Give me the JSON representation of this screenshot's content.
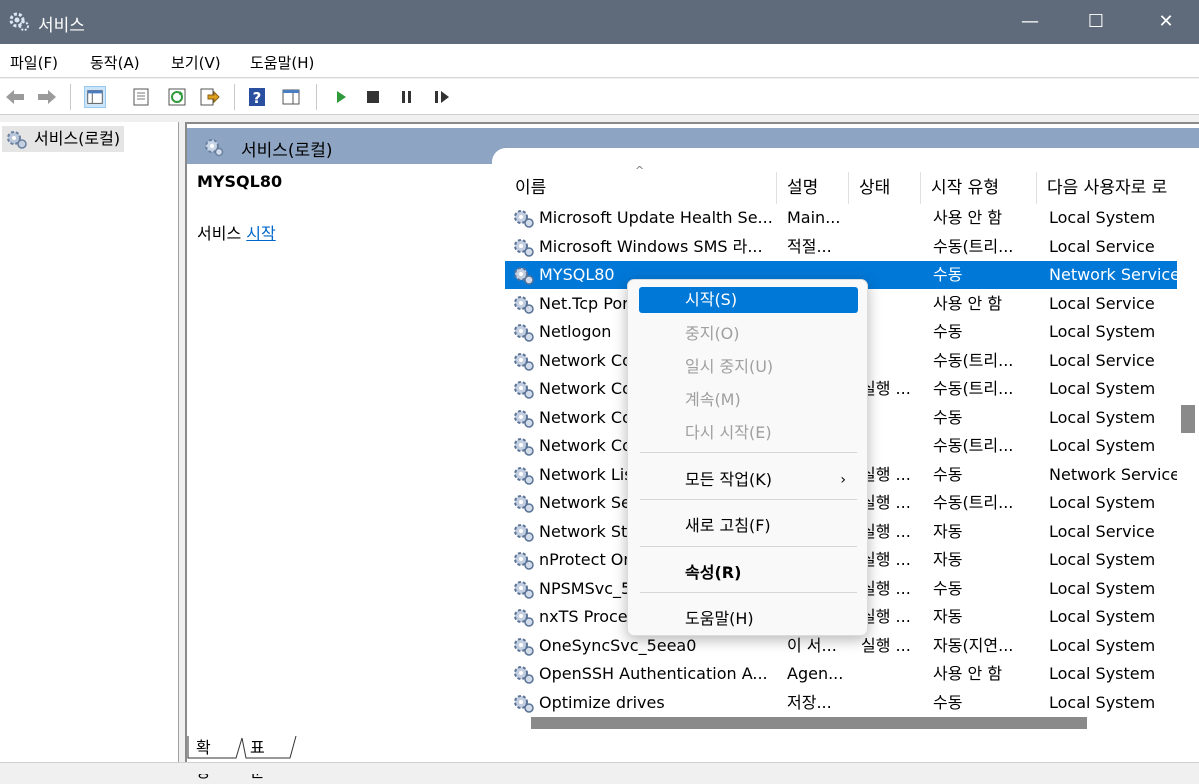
{
  "window": {
    "title": "서비스",
    "controls": {
      "minimize": "—",
      "maximize": "☐",
      "close": "✕"
    }
  },
  "menu": [
    "파일(F)",
    "동작(A)",
    "보기(V)",
    "도움말(H)"
  ],
  "toolbar": [
    "back-arrow-icon",
    "forward-arrow-icon",
    "show-hide-tree-icon",
    "properties-icon",
    "refresh-icon",
    "export-list-icon",
    "help-icon",
    "console-tree-icon",
    "start-service-icon",
    "stop-service-icon",
    "pause-service-icon",
    "resume-service-icon"
  ],
  "tree": {
    "root": "서비스(로컬)"
  },
  "panel": {
    "title": "서비스(로컬)"
  },
  "description": {
    "service_name": "MYSQL80",
    "action_prefix": "서비스 ",
    "action_link": "시작"
  },
  "columns": [
    "이름",
    "설명",
    "상태",
    "시작 유형",
    "다음 사용자로 로"
  ],
  "rows": [
    {
      "name": "Microsoft Update Health Se...",
      "desc": "Main...",
      "status": "",
      "start": "사용 안 함",
      "logon": "Local System"
    },
    {
      "name": "Microsoft Windows SMS 라...",
      "desc": "적절...",
      "status": "",
      "start": "수동(트리...",
      "logon": "Local Service"
    },
    {
      "name": "MYSQL80",
      "desc": "",
      "status": "",
      "start": "수동",
      "logon": "Network Service"
    },
    {
      "name": "Net.Tcp Port Sharing Service",
      "desc": "",
      "status": "",
      "start": "사용 안 함",
      "logon": "Local Service"
    },
    {
      "name": "Netlogon",
      "desc": "",
      "status": "",
      "start": "수동",
      "logon": "Local System"
    },
    {
      "name": "Network Connected Devices",
      "desc": "",
      "status": "",
      "start": "수동(트리...",
      "logon": "Local Service"
    },
    {
      "name": "Network Connection Broker",
      "desc": "",
      "status": "실행 ...",
      "start": "수동(트리...",
      "logon": "Local System"
    },
    {
      "name": "Network Connections",
      "desc": "",
      "status": "",
      "start": "수동",
      "logon": "Local System"
    },
    {
      "name": "Network Connectivity Assistant",
      "desc": "",
      "status": "",
      "start": "수동(트리...",
      "logon": "Local System"
    },
    {
      "name": "Network List Service",
      "desc": "",
      "status": "실행 ...",
      "start": "수동",
      "logon": "Network Service"
    },
    {
      "name": "Network Setup Service",
      "desc": "",
      "status": "실행 ...",
      "start": "수동(트리...",
      "logon": "Local System"
    },
    {
      "name": "Network Store Interface Service",
      "desc": "",
      "status": "실행 ...",
      "start": "자동",
      "logon": "Local Service"
    },
    {
      "name": "nProtect Online Security",
      "desc": "",
      "status": "실행 ...",
      "start": "자동",
      "logon": "Local System"
    },
    {
      "name": "NPSMSvc_5eea0",
      "desc": "",
      "status": "실행 ...",
      "start": "수동",
      "logon": "Local System"
    },
    {
      "name": "nxTS Process Service",
      "desc": "",
      "status": "실행 ...",
      "start": "자동",
      "logon": "Local System"
    },
    {
      "name": "OneSyncSvc_5eea0",
      "desc": "이 서...",
      "status": "실행 ...",
      "start": "자동(지연...",
      "logon": "Local System"
    },
    {
      "name": "OpenSSH Authentication A...",
      "desc": "Agen...",
      "status": "",
      "start": "사용 안 함",
      "logon": "Local System"
    },
    {
      "name": "Optimize drives",
      "desc": "저장...",
      "status": "",
      "start": "수동",
      "logon": "Local System"
    }
  ],
  "tabs": [
    "확장",
    "표준"
  ],
  "context_menu": {
    "start": "시작(S)",
    "stop": "중지(O)",
    "pause": "일시 중지(U)",
    "resume": "계속(M)",
    "restart": "다시 시작(E)",
    "all_tasks": "모든 작업(K)",
    "all_tasks_arrow": "›",
    "refresh": "새로 고침(F)",
    "properties": "속성(R)",
    "help": "도움말(H)"
  }
}
